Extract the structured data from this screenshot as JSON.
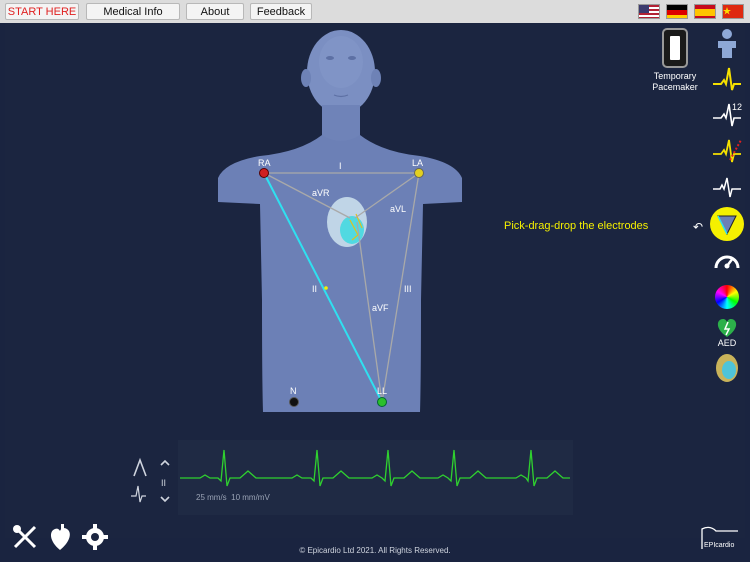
{
  "topbar": {
    "start_here": "START HERE",
    "medical_info": "Medical Info",
    "about": "About",
    "feedback": "Feedback"
  },
  "flags": [
    "us-flag",
    "germany-flag",
    "spain-flag",
    "china-flag"
  ],
  "pacemaker": {
    "label_line1": "Temporary",
    "label_line2": "Pacemaker"
  },
  "electrodes": {
    "ra": "RA",
    "la": "LA",
    "ll": "LL",
    "n": "N"
  },
  "leads": {
    "i": "I",
    "ii": "II",
    "iii": "III",
    "avr": "aVR",
    "avl": "aVL",
    "avf": "aVF"
  },
  "hint": "Pick-drag-drop the electrodes",
  "right_toolbar": {
    "aed_label": "AED",
    "twelve_label": "12"
  },
  "ecg": {
    "speed": "25 mm/s",
    "gain": "10 mm/mV",
    "lead_shown": "II"
  },
  "footer": "© Epicardio Ltd 2021. All Rights Reserved.",
  "logo": "EPIcardio",
  "colors": {
    "accent_yellow": "#f5f000",
    "ecg_green": "#2fd12f",
    "lead_ii_cyan": "#2fe0f0",
    "start_red": "#e02020"
  }
}
